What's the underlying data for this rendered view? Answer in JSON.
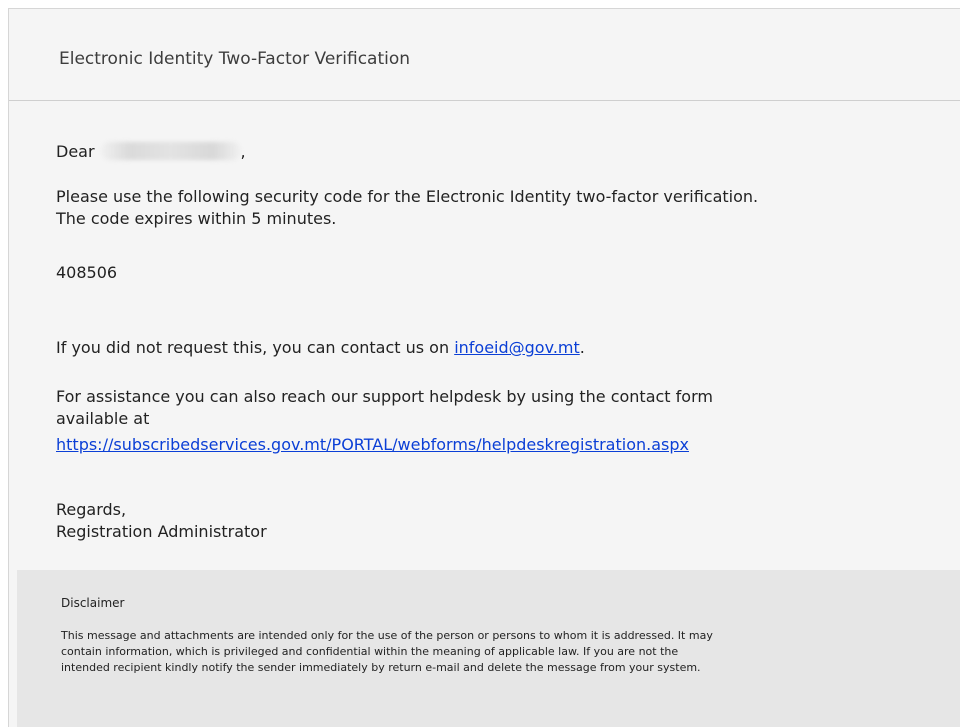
{
  "email": {
    "title": "Electronic Identity Two-Factor Verification",
    "greeting": "Dear",
    "greeting_comma": ",",
    "intro_line1": "Please use the following security code for the Electronic Identity two-factor verification.",
    "intro_line2": "The code expires within 5 minutes.",
    "code": "408506",
    "contact_prefix": "If you did not request this, you can contact us on ",
    "contact_email": "infoeid@gov.mt",
    "contact_suffix": ".",
    "assist_line1": "For assistance you can also reach our support helpdesk by using the contact form",
    "assist_line2": "available at",
    "assist_url": "https://subscribedservices.gov.mt/PORTAL/webforms/helpdeskregistration.aspx",
    "regards": "Regards,",
    "signature": "Registration Administrator"
  },
  "disclaimer": {
    "title": "Disclaimer",
    "line1": "This message and attachments are intended only for the use of the person or persons to whom it is addressed. It may",
    "line2": "contain information, which is privileged and confidential within the meaning of applicable law. If you are not the",
    "line3": "intended recipient kindly notify the sender immediately by return e-mail and delete the message from your system."
  }
}
